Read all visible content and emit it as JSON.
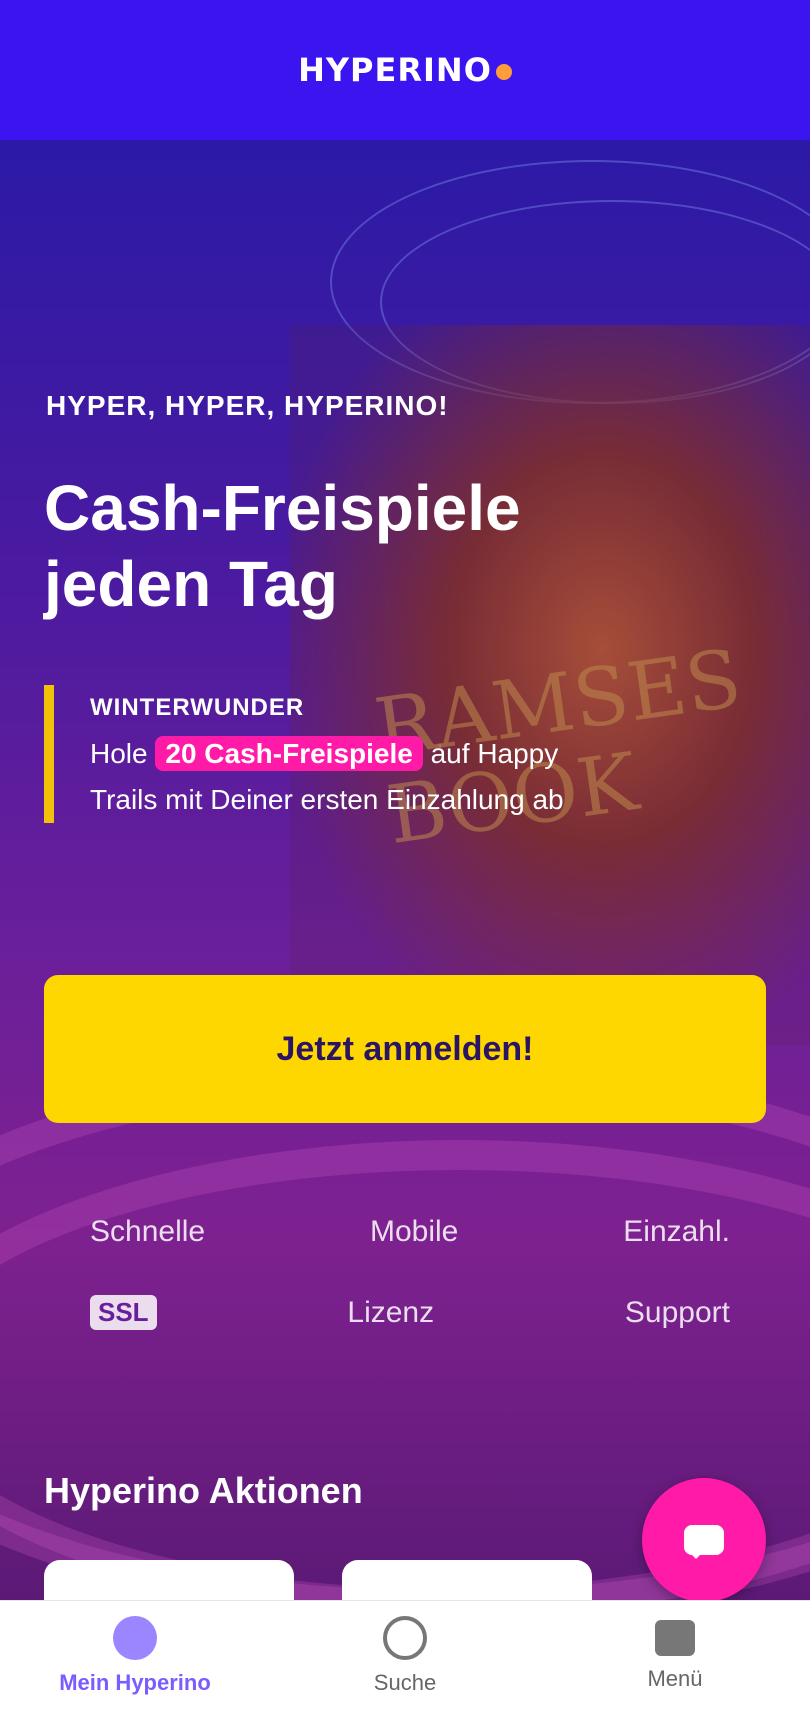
{
  "header": {
    "logo_text": "HYPERINO"
  },
  "hero": {
    "eyebrow": "HYPER, HYPER, HYPERINO!",
    "headline": "Cash-Freispiele jeden Tag",
    "promo_kicker": "WINTERWUNDER",
    "promo_prefix": "Hole",
    "promo_highlight": "20 Cash-Freispiele",
    "promo_suffix": "auf Happy Trails mit Deiner ersten Einzahlung ab",
    "cta_label": "Jetzt anmelden!",
    "info_row_1": [
      "Schnelle",
      "Mobile",
      "Einzahl."
    ],
    "info_row_2": [
      "SSL",
      "Lizenz",
      "Support"
    ]
  },
  "section": {
    "title": "Hyperino Aktionen"
  },
  "fab": {
    "icon": "chat-icon"
  },
  "bottom_nav": [
    {
      "label": "Mein Hyperino",
      "icon": "home-icon",
      "active": true
    },
    {
      "label": "Suche",
      "icon": "search-icon",
      "active": false
    },
    {
      "label": "Menü",
      "icon": "menu-icon",
      "active": false
    }
  ],
  "colors": {
    "topbar": "#3b14f0",
    "cta": "#ffd700",
    "accent_pink": "#ff1aa8",
    "accent_yellow": "#f2c20b",
    "nav_active": "#7b5cff"
  }
}
